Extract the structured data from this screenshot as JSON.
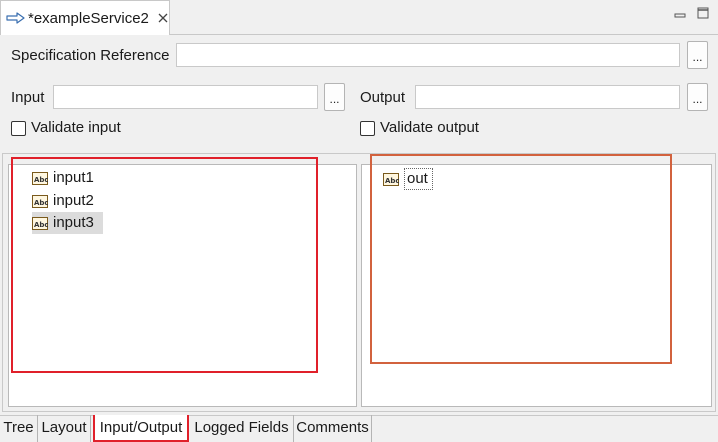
{
  "editor_tab": {
    "title": "*exampleService2",
    "icon": "service-arrow-icon",
    "close_icon": "close-icon"
  },
  "window_controls": [
    "minimize-icon",
    "maximize-icon"
  ],
  "form": {
    "spec_ref_label": "Specification Reference",
    "spec_ref_value": "",
    "input_label": "Input",
    "input_value": "",
    "output_label": "Output",
    "output_value": "",
    "browse_label": "...",
    "validate_input_label": "Validate input",
    "validate_input_checked": false,
    "validate_output_label": "Validate output",
    "validate_output_checked": false
  },
  "input_tree": [
    {
      "label": "input1",
      "icon": "string-field-icon",
      "selected": false
    },
    {
      "label": "input2",
      "icon": "string-field-icon",
      "selected": false
    },
    {
      "label": "input3",
      "icon": "string-field-icon",
      "selected": true
    }
  ],
  "output_tree": [
    {
      "label": "out",
      "icon": "string-field-icon",
      "focused": true
    }
  ],
  "bottom_tabs": [
    {
      "label": "Tree",
      "active": false
    },
    {
      "label": "Layout",
      "active": false
    },
    {
      "label": "Input/Output",
      "active": true
    },
    {
      "label": "Logged Fields",
      "active": false
    },
    {
      "label": "Comments",
      "active": false
    }
  ],
  "colors": {
    "highlight_red": "#e0202a",
    "highlight_orange": "#d2623e",
    "background": "#f0f0f0"
  }
}
